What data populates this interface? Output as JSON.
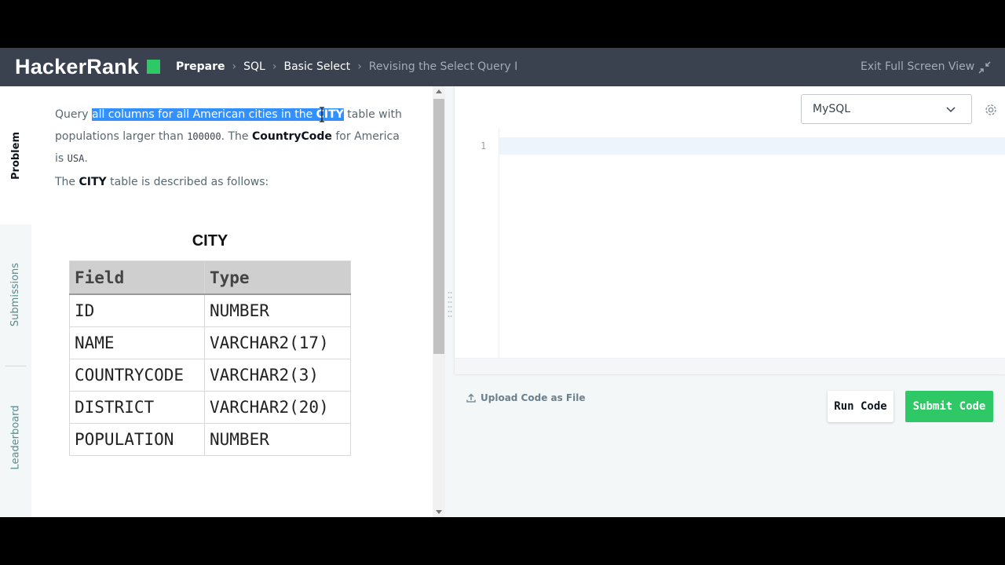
{
  "header": {
    "logo_text": "HackerRank",
    "breadcrumbs": [
      "Prepare",
      "SQL",
      "Basic Select",
      "Revising the Select Query I"
    ],
    "exit_full_screen": "Exit Full Screen View",
    "collapse_icon": "collapse-arrows-icon"
  },
  "sidebar": {
    "tabs": [
      {
        "label": "Problem",
        "active": true
      },
      {
        "label": "Submissions",
        "active": false
      },
      {
        "label": "Leaderboard",
        "active": false
      }
    ]
  },
  "problem": {
    "p1_query": "Query ",
    "p1_selected": "all columns for all American cities in the ",
    "p1_city": "CITY",
    "p1_after_city": " table with populations larger than ",
    "p1_number": "100000",
    "p1_the": ". The ",
    "p1_countrycode": "CountryCode",
    "p1_for_america": " for America is ",
    "p1_usa": "USA",
    "p1_end": ".",
    "p2_the": "The ",
    "p2_city": "CITY",
    "p2_rest": " table is described as follows:",
    "table_caption": "CITY",
    "table_headers": [
      "Field",
      "Type"
    ],
    "table_rows": [
      [
        "ID",
        "NUMBER"
      ],
      [
        "NAME",
        "VARCHAR2(17)"
      ],
      [
        "COUNTRYCODE",
        "VARCHAR2(3)"
      ],
      [
        "DISTRICT",
        "VARCHAR2(20)"
      ],
      [
        "POPULATION",
        "NUMBER"
      ]
    ]
  },
  "editor": {
    "language": "MySQL",
    "line_number": "1",
    "upload_label": "Upload Code as File",
    "run_label": "Run Code",
    "submit_label": "Submit Code",
    "settings_icon": "gear-icon"
  },
  "colors": {
    "header_bg": "#39424e",
    "brand_green": "#2ec866",
    "selection": "#3390ff"
  }
}
